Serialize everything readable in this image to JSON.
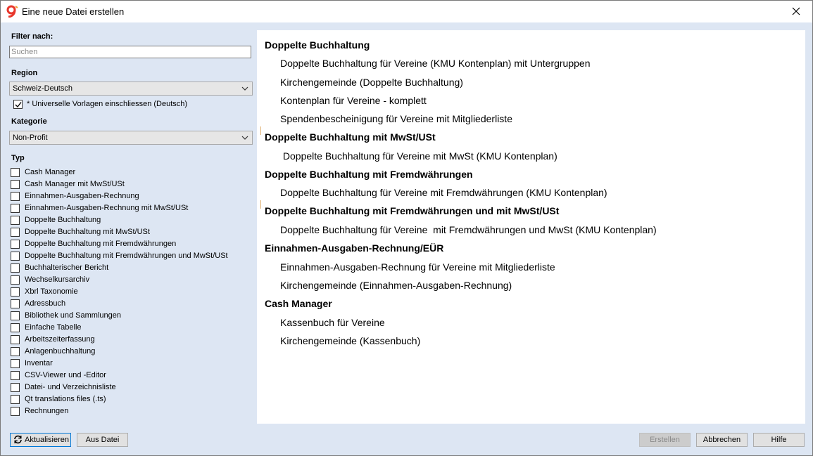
{
  "window": {
    "title": "Eine neue Datei erstellen"
  },
  "filter": {
    "label": "Filter nach:",
    "search_placeholder": "Suchen",
    "search_value": ""
  },
  "region": {
    "label": "Region",
    "selected": "Schweiz-Deutsch",
    "universal_checked": true,
    "universal_label": "* Universelle Vorlagen einschliessen (Deutsch)"
  },
  "kategorie": {
    "label": "Kategorie",
    "selected": "Non-Profit"
  },
  "typ": {
    "label": "Typ",
    "items": [
      "Cash Manager",
      "Cash Manager mit MwSt/USt",
      "Einnahmen-Ausgaben-Rechnung",
      "Einnahmen-Ausgaben-Rechnung mit MwSt/USt",
      "Doppelte Buchhaltung",
      "Doppelte Buchhaltung mit MwSt/USt",
      "Doppelte Buchhaltung mit Fremdwährungen",
      "Doppelte Buchhaltung mit Fremdwährungen und MwSt/USt",
      "Buchhalterischer Bericht",
      "Wechselkursarchiv",
      "Xbrl Taxonomie",
      "Adressbuch",
      "Bibliothek und Sammlungen",
      "Einfache Tabelle",
      "Arbeitszeiterfassung",
      "Anlagenbuchhaltung",
      "Inventar",
      "CSV-Viewer und -Editor",
      "Datei- und Verzeichnisliste",
      "Qt translations files (.ts)",
      "Rechnungen"
    ]
  },
  "templates": [
    {
      "group": "Doppelte Buchhaltung",
      "items": [
        "Doppelte Buchhaltung für Vereine (KMU Kontenplan) mit Untergruppen",
        "Kirchengemeinde (Doppelte Buchhaltung)",
        "Kontenplan für Vereine - komplett",
        "Spendenbescheinigung für Vereine mit Mitgliederliste"
      ]
    },
    {
      "group": "Doppelte Buchhaltung mit MwSt/USt",
      "items": [
        " Doppelte Buchhaltung für Vereine mit MwSt (KMU Kontenplan)"
      ]
    },
    {
      "group": "Doppelte Buchhaltung mit Fremdwährungen",
      "items": [
        "Doppelte Buchhaltung für Vereine mit Fremdwährungen (KMU Kontenplan)"
      ]
    },
    {
      "group": "Doppelte Buchhaltung mit Fremdwährungen und mit MwSt/USt",
      "items": [
        "Doppelte Buchhaltung für Vereine  mit Fremdwährungen und MwSt (KMU Kontenplan)"
      ]
    },
    {
      "group": "Einnahmen-Ausgaben-Rechnung/EÜR",
      "items": [
        "Einnahmen-Ausgaben-Rechnung für Vereine mit Mitgliederliste",
        "Kirchengemeinde (Einnahmen-Ausgaben-Rechnung)"
      ]
    },
    {
      "group": "Cash Manager",
      "items": [
        "Kassenbuch für Vereine",
        "Kirchengemeinde (Kassenbuch)"
      ]
    }
  ],
  "buttons": {
    "refresh": "Aktualisieren",
    "from_file": "Aus Datei",
    "create": "Erstellen",
    "cancel": "Abbrechen",
    "help": "Hilfe"
  },
  "colors": {
    "app_icon": "#e8372c",
    "dialog_bg": "#dde6f3",
    "accent": "#0078d7"
  }
}
